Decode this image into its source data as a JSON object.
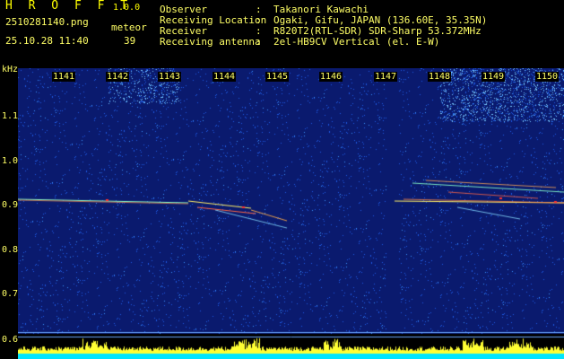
{
  "header": {
    "app_title": "H R O F F T",
    "app_version": "1.0.0",
    "filename": "2510281140.png",
    "datetime": "25.10.28 11:40",
    "meteor_label": "meteor",
    "meteor_count": "39"
  },
  "info": [
    {
      "key": "Observer",
      "value": "Takanori Kawachi"
    },
    {
      "key": "Receiving Location",
      "value": "Ogaki, Gifu, JAPAN (136.60E, 35.35N)"
    },
    {
      "key": "Receiver",
      "value": "R820T2(RTL-SDR) SDR-Sharp 53.372MHz"
    },
    {
      "key": "Receiving antenna",
      "value": "2el-HB9CV Vertical (el. E-W)"
    }
  ],
  "info_colon": ":",
  "yaxis": {
    "unit": "kHz",
    "ticks": [
      "1.1",
      "1.0",
      "0.9",
      "0.8",
      "0.7",
      "0.6"
    ]
  },
  "time_labels": [
    "1141",
    "1142",
    "1143",
    "1144",
    "1145",
    "1146",
    "1147",
    "1148",
    "1149",
    "1150"
  ],
  "colors": {
    "background": "#0a1a6e",
    "text": "#ffff66",
    "echo": "#ff8844",
    "level_fill": "#ffff33",
    "level_base": "#00e5ff"
  }
}
